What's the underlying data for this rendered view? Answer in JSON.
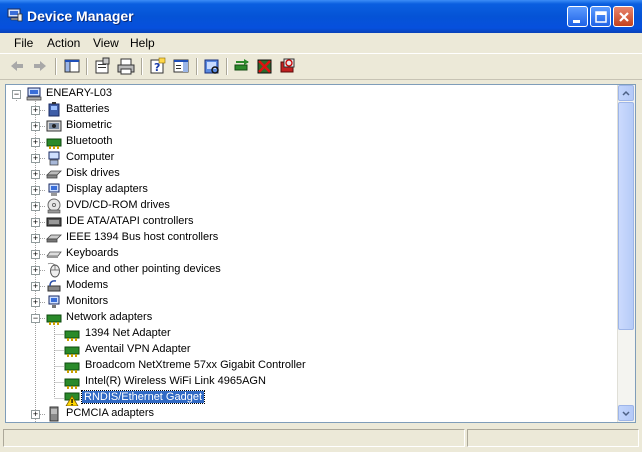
{
  "window": {
    "title": "Device Manager",
    "buttons": [
      "minimize",
      "maximize",
      "close"
    ]
  },
  "menu": [
    "File",
    "Action",
    "View",
    "Help"
  ],
  "toolbar": {
    "icons": [
      "back-arrow-icon",
      "forward-arrow-icon",
      "show-hide-console-tree-icon",
      "properties-icon",
      "print-icon",
      "help-icon",
      "show-hide-action-pane-icon",
      "scan-hardware-icon",
      "update-driver-icon",
      "uninstall-icon",
      "disable-icon"
    ]
  },
  "tree": {
    "root": "ENEARY-L03",
    "categories": [
      {
        "label": "Batteries",
        "icon": "battery-icon"
      },
      {
        "label": "Biometric",
        "icon": "biometric-icon"
      },
      {
        "label": "Bluetooth",
        "icon": "bluetooth-icon"
      },
      {
        "label": "Computer",
        "icon": "computer-icon"
      },
      {
        "label": "Disk drives",
        "icon": "disk-drive-icon"
      },
      {
        "label": "Display adapters",
        "icon": "display-adapter-icon"
      },
      {
        "label": "DVD/CD-ROM drives",
        "icon": "cdrom-icon"
      },
      {
        "label": "IDE ATA/ATAPI controllers",
        "icon": "ide-controller-icon"
      },
      {
        "label": "IEEE 1394 Bus host controllers",
        "icon": "firewire-controller-icon"
      },
      {
        "label": "Keyboards",
        "icon": "keyboard-icon"
      },
      {
        "label": "Mice and other pointing devices",
        "icon": "mouse-icon"
      },
      {
        "label": "Modems",
        "icon": "modem-icon"
      },
      {
        "label": "Monitors",
        "icon": "monitor-icon"
      }
    ],
    "network": {
      "label": "Network adapters",
      "icon": "network-adapter-icon",
      "children": [
        {
          "label": "1394 Net Adapter",
          "icon": "network-card-icon",
          "warning": false
        },
        {
          "label": "Aventail VPN Adapter",
          "icon": "network-card-icon",
          "warning": false
        },
        {
          "label": "Broadcom NetXtreme 57xx Gigabit Controller",
          "icon": "network-card-icon",
          "warning": false
        },
        {
          "label": "Intel(R) Wireless WiFi Link 4965AGN",
          "icon": "network-card-icon",
          "warning": false
        },
        {
          "label": "RNDIS/Ethernet Gadget",
          "icon": "warning-network-card-icon",
          "warning": true,
          "selected": true
        }
      ]
    },
    "after": [
      {
        "label": "PCMCIA adapters",
        "icon": "pcmcia-icon"
      }
    ]
  },
  "colors": {
    "title_bar": "#0553d6",
    "selection": "#316ac5",
    "warning": "#ffd700"
  }
}
